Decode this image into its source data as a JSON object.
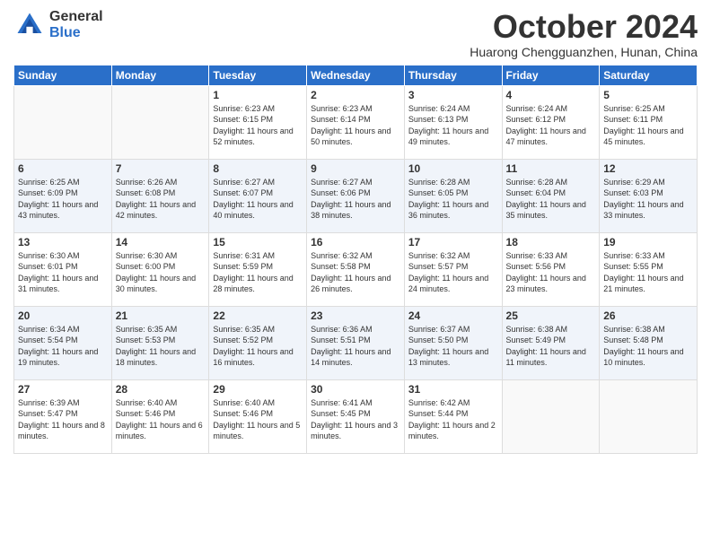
{
  "logo": {
    "general": "General",
    "blue": "Blue"
  },
  "title": "October 2024",
  "subtitle": "Huarong Chengguanzhen, Hunan, China",
  "days_of_week": [
    "Sunday",
    "Monday",
    "Tuesday",
    "Wednesday",
    "Thursday",
    "Friday",
    "Saturday"
  ],
  "weeks": [
    [
      {
        "day": null,
        "sunrise": null,
        "sunset": null,
        "daylight": null
      },
      {
        "day": null,
        "sunrise": null,
        "sunset": null,
        "daylight": null
      },
      {
        "day": 1,
        "sunrise": "Sunrise: 6:23 AM",
        "sunset": "Sunset: 6:15 PM",
        "daylight": "Daylight: 11 hours and 52 minutes."
      },
      {
        "day": 2,
        "sunrise": "Sunrise: 6:23 AM",
        "sunset": "Sunset: 6:14 PM",
        "daylight": "Daylight: 11 hours and 50 minutes."
      },
      {
        "day": 3,
        "sunrise": "Sunrise: 6:24 AM",
        "sunset": "Sunset: 6:13 PM",
        "daylight": "Daylight: 11 hours and 49 minutes."
      },
      {
        "day": 4,
        "sunrise": "Sunrise: 6:24 AM",
        "sunset": "Sunset: 6:12 PM",
        "daylight": "Daylight: 11 hours and 47 minutes."
      },
      {
        "day": 5,
        "sunrise": "Sunrise: 6:25 AM",
        "sunset": "Sunset: 6:11 PM",
        "daylight": "Daylight: 11 hours and 45 minutes."
      }
    ],
    [
      {
        "day": 6,
        "sunrise": "Sunrise: 6:25 AM",
        "sunset": "Sunset: 6:09 PM",
        "daylight": "Daylight: 11 hours and 43 minutes."
      },
      {
        "day": 7,
        "sunrise": "Sunrise: 6:26 AM",
        "sunset": "Sunset: 6:08 PM",
        "daylight": "Daylight: 11 hours and 42 minutes."
      },
      {
        "day": 8,
        "sunrise": "Sunrise: 6:27 AM",
        "sunset": "Sunset: 6:07 PM",
        "daylight": "Daylight: 11 hours and 40 minutes."
      },
      {
        "day": 9,
        "sunrise": "Sunrise: 6:27 AM",
        "sunset": "Sunset: 6:06 PM",
        "daylight": "Daylight: 11 hours and 38 minutes."
      },
      {
        "day": 10,
        "sunrise": "Sunrise: 6:28 AM",
        "sunset": "Sunset: 6:05 PM",
        "daylight": "Daylight: 11 hours and 36 minutes."
      },
      {
        "day": 11,
        "sunrise": "Sunrise: 6:28 AM",
        "sunset": "Sunset: 6:04 PM",
        "daylight": "Daylight: 11 hours and 35 minutes."
      },
      {
        "day": 12,
        "sunrise": "Sunrise: 6:29 AM",
        "sunset": "Sunset: 6:03 PM",
        "daylight": "Daylight: 11 hours and 33 minutes."
      }
    ],
    [
      {
        "day": 13,
        "sunrise": "Sunrise: 6:30 AM",
        "sunset": "Sunset: 6:01 PM",
        "daylight": "Daylight: 11 hours and 31 minutes."
      },
      {
        "day": 14,
        "sunrise": "Sunrise: 6:30 AM",
        "sunset": "Sunset: 6:00 PM",
        "daylight": "Daylight: 11 hours and 30 minutes."
      },
      {
        "day": 15,
        "sunrise": "Sunrise: 6:31 AM",
        "sunset": "Sunset: 5:59 PM",
        "daylight": "Daylight: 11 hours and 28 minutes."
      },
      {
        "day": 16,
        "sunrise": "Sunrise: 6:32 AM",
        "sunset": "Sunset: 5:58 PM",
        "daylight": "Daylight: 11 hours and 26 minutes."
      },
      {
        "day": 17,
        "sunrise": "Sunrise: 6:32 AM",
        "sunset": "Sunset: 5:57 PM",
        "daylight": "Daylight: 11 hours and 24 minutes."
      },
      {
        "day": 18,
        "sunrise": "Sunrise: 6:33 AM",
        "sunset": "Sunset: 5:56 PM",
        "daylight": "Daylight: 11 hours and 23 minutes."
      },
      {
        "day": 19,
        "sunrise": "Sunrise: 6:33 AM",
        "sunset": "Sunset: 5:55 PM",
        "daylight": "Daylight: 11 hours and 21 minutes."
      }
    ],
    [
      {
        "day": 20,
        "sunrise": "Sunrise: 6:34 AM",
        "sunset": "Sunset: 5:54 PM",
        "daylight": "Daylight: 11 hours and 19 minutes."
      },
      {
        "day": 21,
        "sunrise": "Sunrise: 6:35 AM",
        "sunset": "Sunset: 5:53 PM",
        "daylight": "Daylight: 11 hours and 18 minutes."
      },
      {
        "day": 22,
        "sunrise": "Sunrise: 6:35 AM",
        "sunset": "Sunset: 5:52 PM",
        "daylight": "Daylight: 11 hours and 16 minutes."
      },
      {
        "day": 23,
        "sunrise": "Sunrise: 6:36 AM",
        "sunset": "Sunset: 5:51 PM",
        "daylight": "Daylight: 11 hours and 14 minutes."
      },
      {
        "day": 24,
        "sunrise": "Sunrise: 6:37 AM",
        "sunset": "Sunset: 5:50 PM",
        "daylight": "Daylight: 11 hours and 13 minutes."
      },
      {
        "day": 25,
        "sunrise": "Sunrise: 6:38 AM",
        "sunset": "Sunset: 5:49 PM",
        "daylight": "Daylight: 11 hours and 11 minutes."
      },
      {
        "day": 26,
        "sunrise": "Sunrise: 6:38 AM",
        "sunset": "Sunset: 5:48 PM",
        "daylight": "Daylight: 11 hours and 10 minutes."
      }
    ],
    [
      {
        "day": 27,
        "sunrise": "Sunrise: 6:39 AM",
        "sunset": "Sunset: 5:47 PM",
        "daylight": "Daylight: 11 hours and 8 minutes."
      },
      {
        "day": 28,
        "sunrise": "Sunrise: 6:40 AM",
        "sunset": "Sunset: 5:46 PM",
        "daylight": "Daylight: 11 hours and 6 minutes."
      },
      {
        "day": 29,
        "sunrise": "Sunrise: 6:40 AM",
        "sunset": "Sunset: 5:46 PM",
        "daylight": "Daylight: 11 hours and 5 minutes."
      },
      {
        "day": 30,
        "sunrise": "Sunrise: 6:41 AM",
        "sunset": "Sunset: 5:45 PM",
        "daylight": "Daylight: 11 hours and 3 minutes."
      },
      {
        "day": 31,
        "sunrise": "Sunrise: 6:42 AM",
        "sunset": "Sunset: 5:44 PM",
        "daylight": "Daylight: 11 hours and 2 minutes."
      },
      {
        "day": null,
        "sunrise": null,
        "sunset": null,
        "daylight": null
      },
      {
        "day": null,
        "sunrise": null,
        "sunset": null,
        "daylight": null
      }
    ]
  ]
}
